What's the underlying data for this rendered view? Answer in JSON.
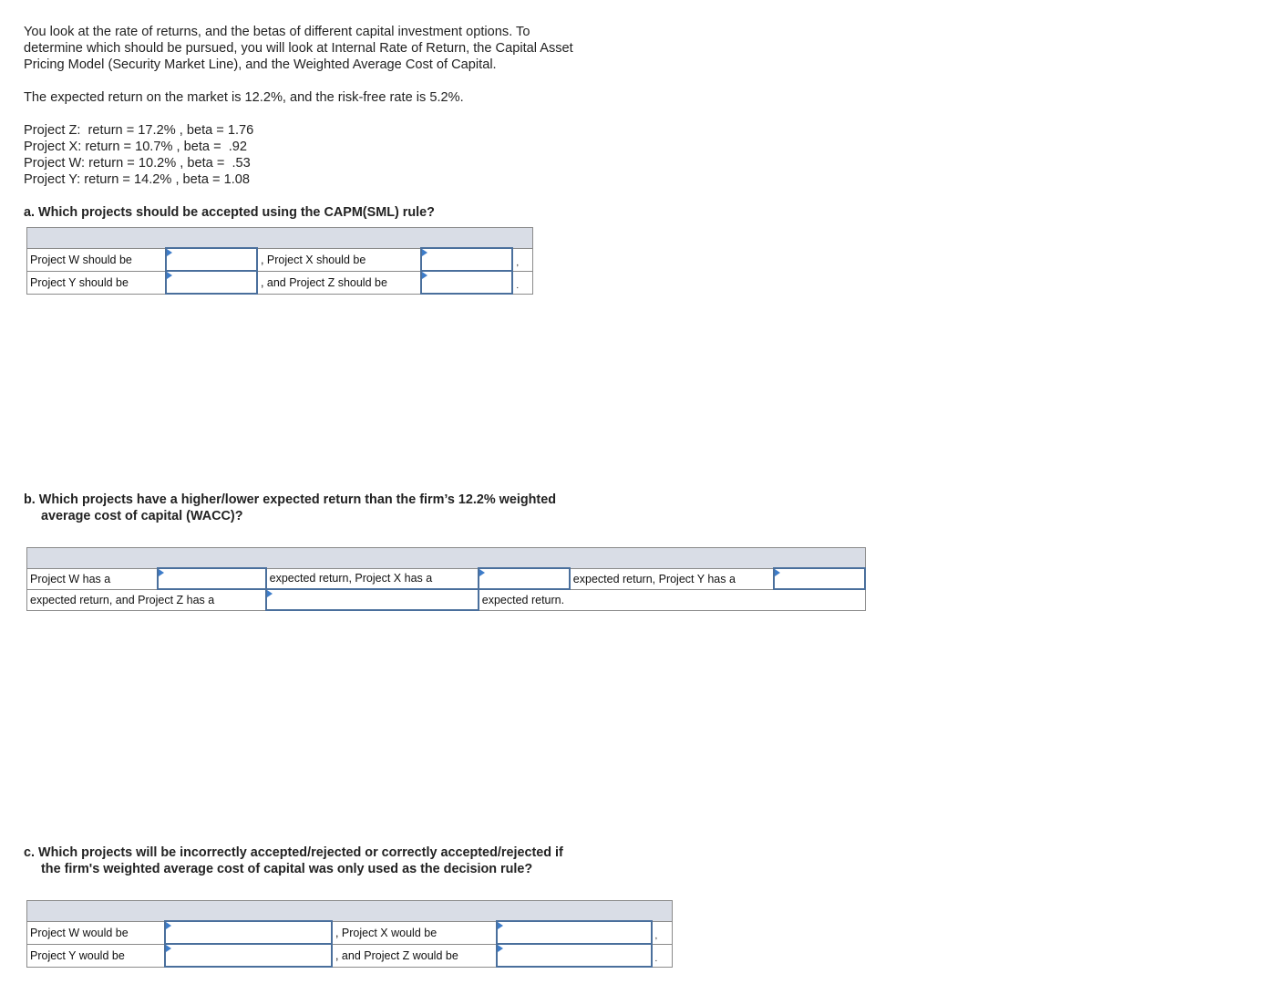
{
  "intro": {
    "lines": [
      "You look at the rate of returns, and the betas of different capital investment options.  To",
      "determine which should be pursued, you will look at Internal Rate of Return, the Capital Asset",
      "Pricing Model (Security Market Line), and the Weighted Average Cost of Capital."
    ],
    "market_statement": "The expected return on the market is 12.2%, and the risk-free rate is 5.2%."
  },
  "projects": [
    {
      "text": "Project Z:  return = 17.2% , beta = 1.76"
    },
    {
      "text": "Project X: return = 10.7% , beta =  .92"
    },
    {
      "text": "Project W: return = 10.2% , beta =  .53"
    },
    {
      "text": "Project Y: return = 14.2% , beta = 1.08"
    }
  ],
  "question_a": {
    "prompt": "a. Which projects should be accepted using the CAPM(SML) rule?",
    "row1": {
      "label1": "Project W should be",
      "value1": "",
      "label2": ", Project X should be",
      "value2": "",
      "punct": ","
    },
    "row2": {
      "label1": "Project Y should be",
      "value1": "",
      "label2": ", and Project Z should be",
      "value2": "",
      "punct": "."
    }
  },
  "question_b": {
    "prompt_line1": "b. Which projects have a higher/lower expected return than the firm’s 12.2% weighted",
    "prompt_line2": "average cost of capital (WACC)?",
    "row1": {
      "label1": "Project W has a",
      "value1": "",
      "label2": "expected return, Project X has a",
      "value2": "",
      "label3": "expected return, Project Y has a",
      "value3": ""
    },
    "row2": {
      "label1": "expected return, and Project Z has a",
      "value1": "",
      "label2": "expected return."
    }
  },
  "question_c": {
    "prompt_line1": "c. Which projects will be incorrectly accepted/rejected or correctly accepted/rejected if",
    "prompt_line2": "the firm's weighted average cost of capital was only used as the decision rule?",
    "row1": {
      "label1": "Project W would be",
      "value1": "",
      "label2": ", Project X would be",
      "value2": "",
      "punct": ","
    },
    "row2": {
      "label1": "Project Y would be",
      "value1": "",
      "label2": ", and Project Z would be",
      "value2": "",
      "punct": "."
    }
  }
}
